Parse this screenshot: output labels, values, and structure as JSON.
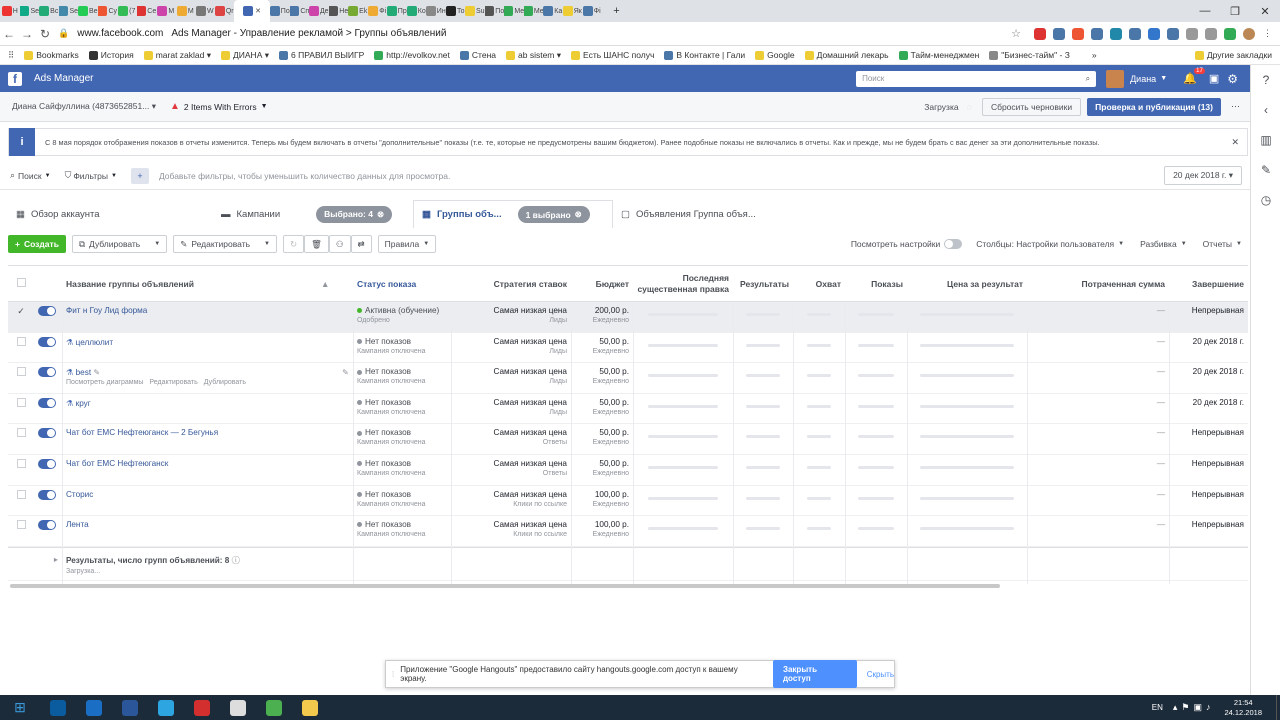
{
  "browser": {
    "tabs": [
      {
        "label": "Н",
        "color": "#e33"
      },
      {
        "label": "Se",
        "color": "#1a8"
      },
      {
        "label": "Вс",
        "color": "#2a7"
      },
      {
        "label": "Se",
        "color": "#48a"
      },
      {
        "label": "Ве",
        "color": "#2c5"
      },
      {
        "label": "Су",
        "color": "#e53"
      },
      {
        "label": "(7",
        "color": "#3b5"
      },
      {
        "label": "Се",
        "color": "#d33"
      },
      {
        "label": "M",
        "color": "#c4a"
      },
      {
        "label": "M",
        "color": "#ea3"
      },
      {
        "label": "W",
        "color": "#777"
      },
      {
        "label": "Qr",
        "color": "#d44"
      },
      {
        "label": "",
        "color": "#4267b2"
      },
      {
        "label": "По",
        "color": "#4a76a8"
      },
      {
        "label": "Сп",
        "color": "#4a76a8"
      },
      {
        "label": "Де",
        "color": "#c4a"
      },
      {
        "label": "Не",
        "color": "#555"
      },
      {
        "label": "Еk",
        "color": "#7a3"
      },
      {
        "label": "Фі",
        "color": "#ea3"
      },
      {
        "label": "Пр",
        "color": "#2a7"
      },
      {
        "label": "Ко",
        "color": "#2a7"
      },
      {
        "label": "Ин",
        "color": "#888"
      },
      {
        "label": "То",
        "color": "#222"
      },
      {
        "label": "Su",
        "color": "#ec3"
      },
      {
        "label": "По",
        "color": "#555"
      },
      {
        "label": "Ме",
        "color": "#3a5"
      },
      {
        "label": "Ме",
        "color": "#3a5"
      },
      {
        "label": "Ка",
        "color": "#4a76a8"
      },
      {
        "label": "Як",
        "color": "#ec3"
      },
      {
        "label": "Фі",
        "color": "#4a76a8"
      }
    ],
    "active_tab_index": 12,
    "new_tab": "+",
    "url_domain": "www.facebook.com",
    "page_title": "Ads Manager - Управление рекламой > Группы объявлений",
    "bookmarks": [
      {
        "label": "Bookmarks",
        "color": "#ec3"
      },
      {
        "label": "История",
        "color": "#333"
      },
      {
        "label": "marat zaklad ▾",
        "color": "#ec3"
      },
      {
        "label": "ДИАНА ▾",
        "color": "#ec3"
      },
      {
        "label": "6 ПРАВИЛ ВЫИГР",
        "color": "#4a76a8"
      },
      {
        "label": "http://evolkov.net",
        "color": "#3a5"
      },
      {
        "label": "Стена",
        "color": "#4a76a8"
      },
      {
        "label": "ab sistem ▾",
        "color": "#ec3"
      },
      {
        "label": "Есть ШАНС получ",
        "color": "#ec3"
      },
      {
        "label": "В Контакте | Гали",
        "color": "#4a76a8"
      },
      {
        "label": "Google",
        "color": "#ec3"
      },
      {
        "label": "Домашний лекарь",
        "color": "#ec3"
      },
      {
        "label": "Тайм-менеджмен",
        "color": "#3a5"
      },
      {
        "label": "\"Бизнес-тайм\" - З",
        "color": "#888"
      },
      {
        "label": "»",
        "color": "#fff"
      }
    ],
    "other_bookmarks": "Другие закладки"
  },
  "fb": {
    "app_title": "Ads Manager",
    "search_placeholder": "Поиск",
    "user_name": "Диана",
    "notif_count": "17",
    "account_name": "Диана Сайфуллина (4873652851...",
    "errors_label": "2 Items With Errors",
    "loading_label": "Загрузка",
    "discard_label": "Сбросить черновики",
    "publish_label": "Проверка и публикация (13)",
    "notice_text": "С 8 мая порядок отображения показов в отчеты изменится. Теперь мы будем включать в отчеты \"дополнительные\" показы (т.е. те, которые не предусмотрены вашим бюджетом). Ранее подобные показы не включались в отчеты. Как и прежде, мы не будем брать с вас денег за эти дополнительные показы.",
    "search_btn": "Поиск",
    "filters_btn": "Фильтры",
    "filter_placeholder": "Добавьте фильтры, чтобы уменьшить количество данных для просмотра.",
    "date_range": "20 дек 2018 г.",
    "level_tabs": {
      "account": "Обзор аккаунта",
      "campaigns": "Кампании",
      "campaigns_selected": "Выбрано: 4",
      "adsets": "Группы объ...",
      "adsets_selected": "1 выбрано",
      "ads": "Объявления Группа объя..."
    },
    "toolbar": {
      "create": "Создать",
      "duplicate": "Дублировать",
      "edit": "Редактировать",
      "rules": "Правила",
      "view_setup": "Посмотреть настройки",
      "columns": "Столбцы: Настройки пользователя",
      "breakdown": "Разбивка",
      "reports": "Отчеты"
    },
    "columns": {
      "name": "Название группы объявлений",
      "status": "Статус показа",
      "bid": "Стратегия ставок",
      "budget": "Бюджет",
      "last_edit": "Последняя существенная правка",
      "results": "Результаты",
      "reach": "Охват",
      "impressions": "Показы",
      "cost": "Цена за результат",
      "spent": "Потраченная сумма",
      "end": "Завершение"
    },
    "rows": [
      {
        "name": "Фит н Гоу Лид форма",
        "status": "Активна (обучение)",
        "status_sub": "Одобрено",
        "status_color": "#42b72a",
        "bid": "Самая низкая цена",
        "bid_sub": "Лиды",
        "budget": "200,00 р.",
        "budget_sub": "Ежедневно",
        "spent": "—",
        "end": "Непрерывная",
        "selected": true,
        "draft": false
      },
      {
        "name": "целлюлит",
        "status": "Нет показов",
        "status_sub": "Кампания отключена",
        "status_color": "#90949c",
        "bid": "Самая низкая цена",
        "bid_sub": "Лиды",
        "budget": "50,00 р.",
        "budget_sub": "Ежедневно",
        "spent": "—",
        "end": "20 дек 2018 г.",
        "selected": false,
        "draft": true
      },
      {
        "name": "best",
        "status": "Нет показов",
        "status_sub": "Кампания отключена",
        "status_color": "#90949c",
        "bid": "Самая низкая цена",
        "bid_sub": "Лиды",
        "budget": "50,00 р.",
        "budget_sub": "Ежедневно",
        "spent": "—",
        "end": "20 дек 2018 г.",
        "selected": false,
        "draft": true,
        "hover": true
      },
      {
        "name": "круг",
        "status": "Нет показов",
        "status_sub": "Кампания отключена",
        "status_color": "#90949c",
        "bid": "Самая низкая цена",
        "bid_sub": "Лиды",
        "budget": "50,00 р.",
        "budget_sub": "Ежедневно",
        "spent": "—",
        "end": "20 дек 2018 г.",
        "selected": false,
        "draft": true
      },
      {
        "name": "Чат бот ЕМС Нефтеюганск — 2 Бегунья",
        "status": "Нет показов",
        "status_sub": "Кампания отключена",
        "status_color": "#90949c",
        "bid": "Самая низкая цена",
        "bid_sub": "Ответы",
        "budget": "50,00 р.",
        "budget_sub": "Ежедневно",
        "spent": "—",
        "end": "Непрерывная",
        "selected": false,
        "draft": false
      },
      {
        "name": "Чат бот ЕМС Нефтеюганск",
        "status": "Нет показов",
        "status_sub": "Кампания отключена",
        "status_color": "#90949c",
        "bid": "Самая низкая цена",
        "bid_sub": "Ответы",
        "budget": "50,00 р.",
        "budget_sub": "Ежедневно",
        "spent": "—",
        "end": "Непрерывная",
        "selected": false,
        "draft": false
      },
      {
        "name": "Сторис",
        "status": "Нет показов",
        "status_sub": "Кампания отключена",
        "status_color": "#90949c",
        "bid": "Самая низкая цена",
        "bid_sub": "Клики по ссылке",
        "budget": "100,00 р.",
        "budget_sub": "Ежедневно",
        "spent": "—",
        "end": "Непрерывная",
        "selected": false,
        "draft": false
      },
      {
        "name": "Лента",
        "status": "Нет показов",
        "status_sub": "Кампания отключена",
        "status_color": "#90949c",
        "bid": "Самая низкая цена",
        "bid_sub": "Клики по ссылке",
        "budget": "100,00 р.",
        "budget_sub": "Ежедневно",
        "spent": "—",
        "end": "Непрерывная",
        "selected": false,
        "draft": false
      }
    ],
    "row_hover_actions": {
      "charts": "Посмотреть диаграммы",
      "edit": "Редактировать",
      "duplicate": "Дублировать"
    },
    "summary": "Результаты, число групп объявлений: 8",
    "summary_sub": "Загрузка..."
  },
  "hangouts": {
    "text": "Приложение \"Google Hangouts\" предоставило сайту hangouts.google.com доступ к вашему экрану.",
    "stop": "Закрыть доступ",
    "hide": "Скрыть"
  },
  "taskbar": {
    "lang": "EN",
    "time": "21:54",
    "date": "24.12.2018",
    "apps": [
      {
        "color": "#0a5c9e"
      },
      {
        "color": "#1a6fc4"
      },
      {
        "color": "#2b579a"
      },
      {
        "color": "#2ca5e0"
      },
      {
        "color": "#d32f2f"
      },
      {
        "color": "#ddd"
      },
      {
        "color": "#4caf50"
      },
      {
        "color": "#f2c94c"
      }
    ]
  }
}
